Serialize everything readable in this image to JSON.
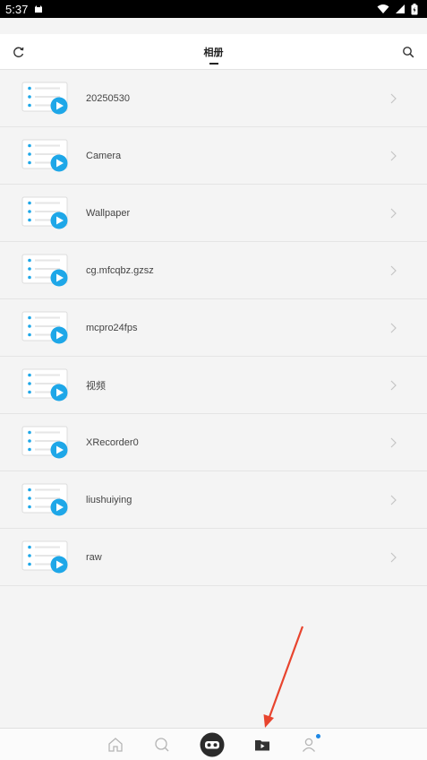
{
  "status": {
    "time": "5:37"
  },
  "header": {
    "title": "相册"
  },
  "albums": [
    {
      "name": "20250530"
    },
    {
      "name": "Camera"
    },
    {
      "name": "Wallpaper"
    },
    {
      "name": "cg.mfcqbz.gzsz"
    },
    {
      "name": "mcpro24fps"
    },
    {
      "name": "视频"
    },
    {
      "name": "XRecorder0"
    },
    {
      "name": "liushuiying"
    },
    {
      "name": "raw"
    }
  ],
  "bottom_nav": {
    "items": [
      {
        "icon": "home-icon"
      },
      {
        "icon": "search-icon"
      },
      {
        "icon": "vr-goggles-icon"
      },
      {
        "icon": "video-folder-icon"
      },
      {
        "icon": "profile-icon",
        "has_notification_dot": true
      }
    ]
  },
  "colors": {
    "accent": "#1ea7e8",
    "annotation_arrow": "#e8442e"
  }
}
